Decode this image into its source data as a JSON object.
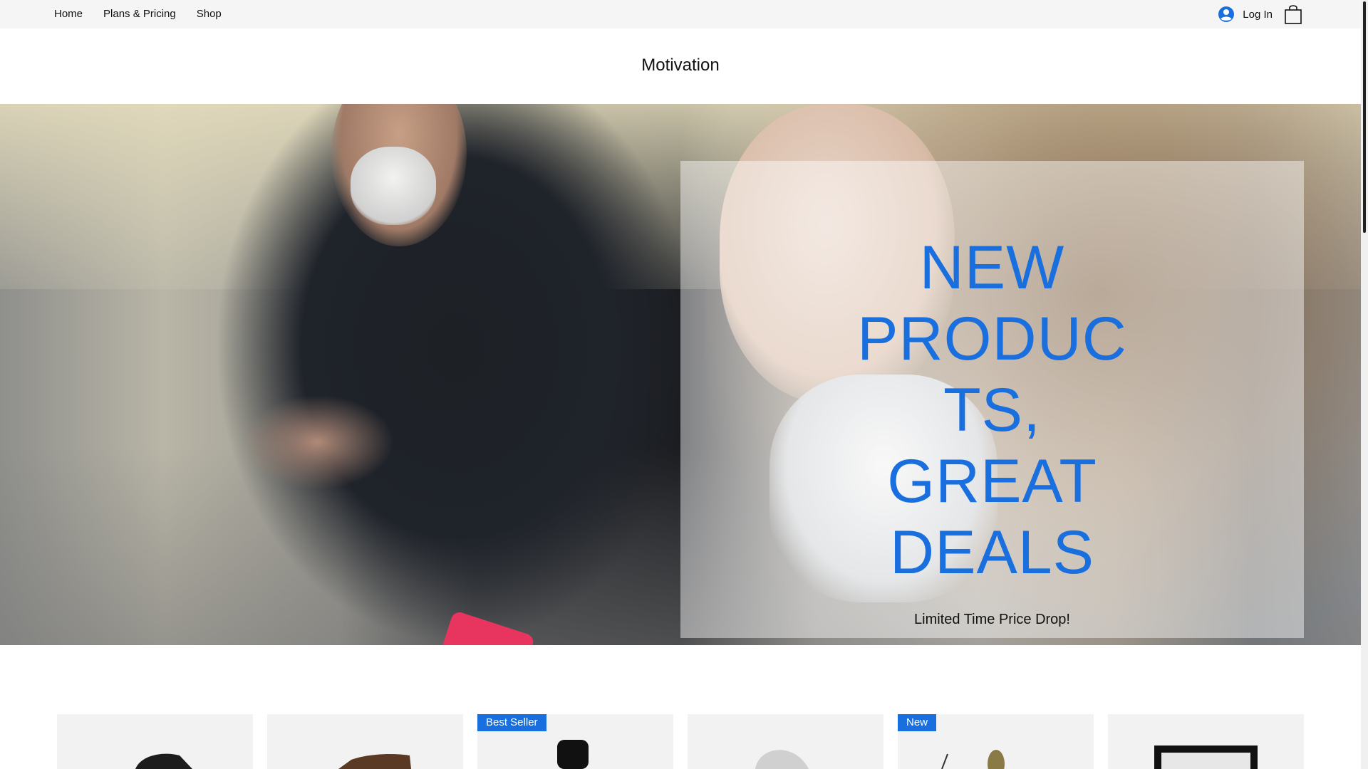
{
  "nav": {
    "items": [
      {
        "label": "Home"
      },
      {
        "label": "Plans & Pricing"
      },
      {
        "label": "Shop"
      }
    ],
    "login_label": "Log In",
    "login_icon": "user-avatar-icon",
    "cart_icon": "shopping-bag-icon"
  },
  "site": {
    "title": "Motivation"
  },
  "hero": {
    "headline_lines": [
      "NEW",
      "PRODUC",
      "TS,",
      "GREAT",
      "DEALS"
    ],
    "subline": "Limited Time Price Drop!",
    "accent_color": "#1a6fde"
  },
  "products": {
    "cards": [
      {
        "badge": ""
      },
      {
        "badge": ""
      },
      {
        "badge": "Best Seller"
      },
      {
        "badge": ""
      },
      {
        "badge": "New"
      },
      {
        "badge": ""
      }
    ]
  }
}
